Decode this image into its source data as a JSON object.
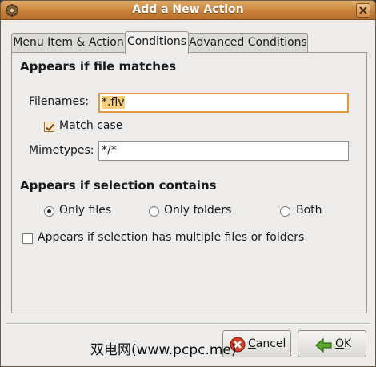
{
  "window": {
    "title": "Add a New Action"
  },
  "tabs": [
    {
      "label": "Menu Item & Action",
      "active": false
    },
    {
      "label": "Conditions",
      "active": true
    },
    {
      "label": "Advanced Conditions",
      "active": false
    }
  ],
  "file_match": {
    "section_title": "Appears if file matches",
    "filenames_label": "Filenames:",
    "filenames_value": "*.flv",
    "match_case_label": "Match case",
    "match_case_checked": true,
    "mimetypes_label": "Mimetypes:",
    "mimetypes_value": "*/*"
  },
  "selection": {
    "section_title": "Appears if selection contains",
    "options": [
      {
        "label": "Only files",
        "selected": true
      },
      {
        "label": "Only folders",
        "selected": false
      },
      {
        "label": "Both",
        "selected": false
      }
    ],
    "multiple_label": "Appears if selection has multiple files or folders",
    "multiple_checked": false
  },
  "buttons": {
    "cancel_mnemonic": "C",
    "cancel_rest": "ancel",
    "ok_mnemonic": "O",
    "ok_rest": "K"
  },
  "watermark": "双电网(www.pcpc.me)",
  "colors": {
    "titlebar": "#c9823a",
    "focus_border": "#e09a3a",
    "selection_highlight": "#f6cf7a"
  },
  "icons": {
    "window": "gear-icon",
    "close": "close-icon",
    "cancel": "cancel-icon",
    "ok": "ok-arrow-icon"
  }
}
